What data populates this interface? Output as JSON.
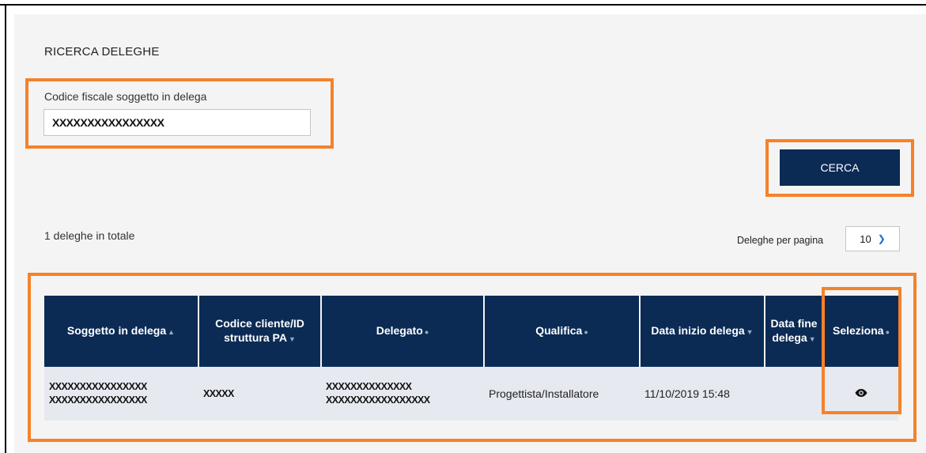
{
  "search": {
    "title": "RICERCA DELEGHE",
    "field_label": "Codice fiscale soggetto in delega",
    "field_value": "XXXXXXXXXXXXXXXX",
    "button_label": "CERCA"
  },
  "results": {
    "total_text": "1 deleghe in totale",
    "per_page_label": "Deleghe per pagina",
    "per_page_value": "10",
    "columns": [
      "Soggetto in delega",
      "Codice cliente/ID struttura PA",
      "Delegato",
      "Qualifica",
      "Data inizio delega",
      "Data fine delega",
      "Seleziona"
    ],
    "rows": [
      {
        "soggetto_line1": "XXXXXXXXXXXXXXXX",
        "soggetto_line2": "XXXXXXXXXXXXXXXX",
        "codice": "XXXXX",
        "delegato_line1": "XXXXXXXXXXXXXX",
        "delegato_line2": "XXXXXXXXXXXXXXXXX",
        "qualifica": "Progettista/Installatore",
        "data_inizio": "11/10/2019 15:48",
        "data_fine": "",
        "seleziona_icon": "eye-icon"
      }
    ]
  },
  "colors": {
    "highlight": "#f5822a",
    "primary": "#0b2b55",
    "panel_bg": "#f4f4f4",
    "row_bg": "#e6e9f0"
  }
}
